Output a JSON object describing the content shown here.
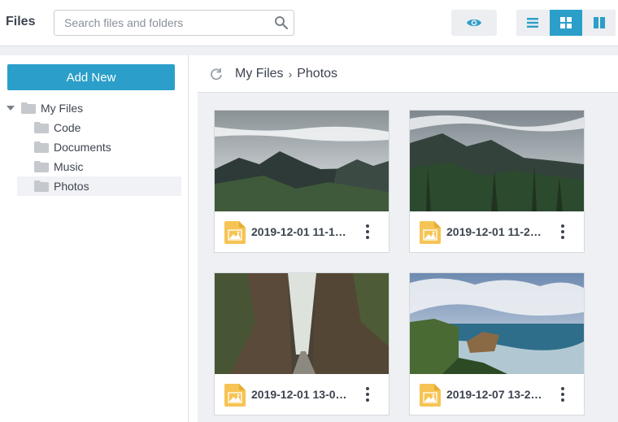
{
  "header": {
    "title": "Files",
    "search_placeholder": "Search files and folders"
  },
  "colors": {
    "accent": "#2b9fc9",
    "folder": "#c5c8cc",
    "image_file": "#f6c454"
  },
  "sidebar": {
    "add_new_label": "Add New",
    "tree": [
      {
        "label": "My Files",
        "icon": "folder-icon",
        "expanded": true,
        "level": 0
      },
      {
        "label": "Code",
        "icon": "folder-icon",
        "level": 1
      },
      {
        "label": "Documents",
        "icon": "folder-icon",
        "level": 1
      },
      {
        "label": "Music",
        "icon": "folder-icon",
        "level": 1
      },
      {
        "label": "Photos",
        "icon": "folder-icon",
        "level": 1,
        "selected": true
      }
    ]
  },
  "breadcrumb": [
    "My Files",
    "Photos"
  ],
  "view_modes": [
    "list-icon",
    "grid-icon",
    "columns-icon"
  ],
  "active_view": "grid-icon",
  "files": [
    {
      "name": "2019-12-01 11-1…",
      "icon": "image-file-icon"
    },
    {
      "name": "2019-12-01 11-2…",
      "icon": "image-file-icon"
    },
    {
      "name": "2019-12-01 13-0…",
      "icon": "image-file-icon"
    },
    {
      "name": "2019-12-07 13-2…",
      "icon": "image-file-icon"
    }
  ]
}
